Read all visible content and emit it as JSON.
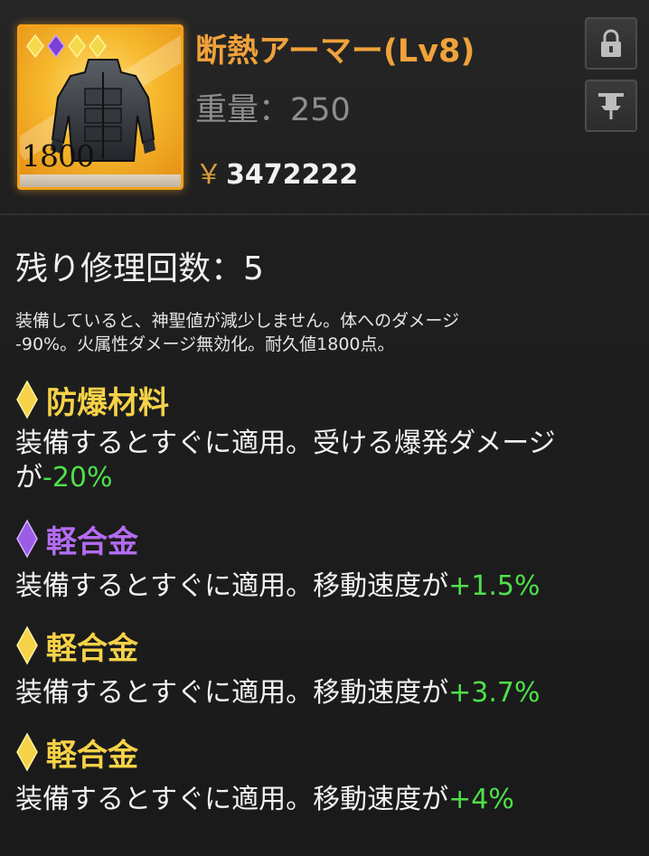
{
  "item": {
    "count": "1800",
    "title": "断熱アーマー(Lv8)",
    "weight": "重量：250",
    "currency_symbol": "￥",
    "price": "3472222",
    "gems": [
      "gold",
      "purple",
      "gold",
      "gold"
    ]
  },
  "buttons": {
    "lock_icon": "lock-icon",
    "pin_icon": "pin-icon"
  },
  "repair": "残り修理回数：5",
  "description": {
    "line1": "装備していると、神聖値が減少しません。体へのダメージ",
    "line2": "-90%。火属性ダメージ無効化。耐久値1800点。"
  },
  "modifiers": [
    {
      "gem": "gold",
      "name": "防爆材料",
      "text_line1": "装備するとすぐに適用。受ける爆発ダメージ",
      "text_prefix": "が",
      "value": "-20%"
    },
    {
      "gem": "purple",
      "name": "軽合金",
      "text_prefix": "装備するとすぐに適用。移動速度が",
      "value": "+1.5%"
    },
    {
      "gem": "gold",
      "name": "軽合金",
      "text_prefix": "装備するとすぐに適用。移動速度が",
      "value": "+3.7%"
    },
    {
      "gem": "gold",
      "name": "軽合金",
      "text_prefix": "装備するとすぐに適用。移動速度が",
      "value": "+4%"
    }
  ],
  "colors": {
    "gold_gem": "#f5d247",
    "purple_gem": "#9b5de5",
    "title": "#f0a23a",
    "positive": "#4ee04a"
  }
}
